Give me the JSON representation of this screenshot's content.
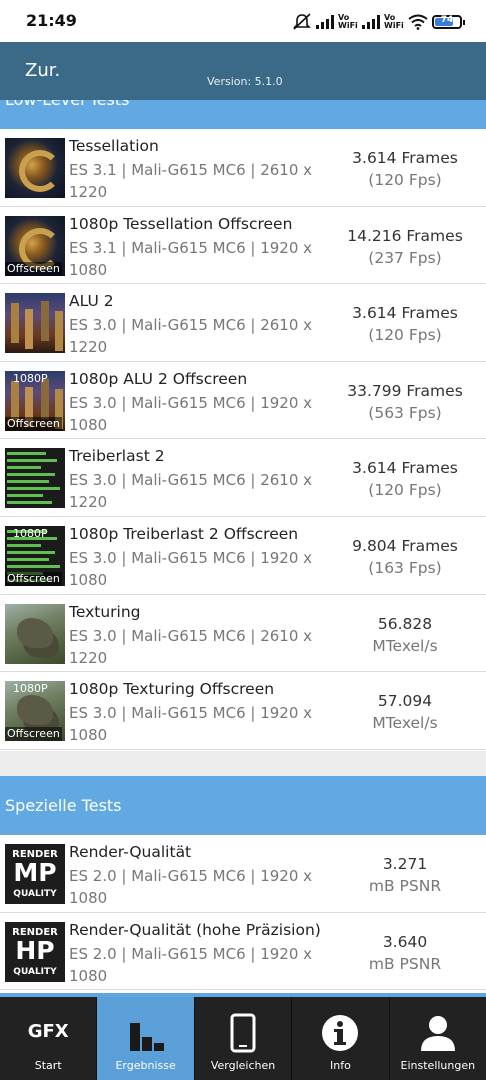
{
  "status_bar": {
    "time": "21:49",
    "network_label_1": "Vo WiFi",
    "network_label_2": "Vo WiFi",
    "battery_level": "74"
  },
  "header": {
    "back_label": "Zur.",
    "version": "Version: 5.1.0"
  },
  "sections": {
    "low_level_title": "Low-Level Tests",
    "special_title": "Spezielle Tests"
  },
  "low_level_tests": [
    {
      "title": "Tessellation",
      "api": "ES 3.1 | Mali-G615 MC6 | 2610 x 1220",
      "value": "3.614 Frames",
      "unit": "(120 Fps)",
      "thumb": "tessellation-thumbnail",
      "badge_bottom": "",
      "badge_top": ""
    },
    {
      "title": "1080p Tessellation Offscreen",
      "api": "ES 3.1 | Mali-G615 MC6 | 1920 x 1080",
      "value": "14.216 Frames",
      "unit": "(237 Fps)",
      "thumb": "tessellation-thumbnail",
      "badge_bottom": "Offscreen",
      "badge_top": ""
    },
    {
      "title": "ALU 2",
      "api": "ES 3.0 | Mali-G615 MC6 | 2610 x 1220",
      "value": "3.614 Frames",
      "unit": "(120 Fps)",
      "thumb": "alu-thumbnail",
      "badge_bottom": "",
      "badge_top": ""
    },
    {
      "title": "1080p ALU 2 Offscreen",
      "api": "ES 3.0 | Mali-G615 MC6 | 1920 x 1080",
      "value": "33.799 Frames",
      "unit": "(563 Fps)",
      "thumb": "alu-thumbnail",
      "badge_bottom": "Offscreen",
      "badge_top": "1080P"
    },
    {
      "title": "Treiberlast 2",
      "api": "ES 3.0 | Mali-G615 MC6 | 2610 x 1220",
      "value": "3.614 Frames",
      "unit": "(120 Fps)",
      "thumb": "driver-overhead-thumbnail",
      "badge_bottom": "",
      "badge_top": ""
    },
    {
      "title": "1080p Treiberlast 2 Offscreen",
      "api": "ES 3.0 | Mali-G615 MC6 | 1920 x 1080",
      "value": "9.804 Frames",
      "unit": "(163 Fps)",
      "thumb": "driver-overhead-thumbnail",
      "badge_bottom": "Offscreen",
      "badge_top": "1080P"
    },
    {
      "title": "Texturing",
      "api": "ES 3.0 | Mali-G615 MC6 | 2610 x 1220",
      "value": "56.828",
      "unit": "MTexel/s",
      "thumb": "texturing-thumbnail",
      "badge_bottom": "",
      "badge_top": ""
    },
    {
      "title": "1080p Texturing Offscreen",
      "api": "ES 3.0 | Mali-G615 MC6 | 1920 x 1080",
      "value": "57.094",
      "unit": "MTexel/s",
      "thumb": "texturing-thumbnail",
      "badge_bottom": "Offscreen",
      "badge_top": "1080P"
    }
  ],
  "special_tests": [
    {
      "title": "Render-Qualität",
      "api": "ES 2.0 | Mali-G615 MC6 | 1920 x 1080",
      "value": "3.271",
      "unit": "mB PSNR",
      "badge_top": "RENDER",
      "badge_main": "MP",
      "badge_bottom": "QUALITY"
    },
    {
      "title": "Render-Qualität (hohe Präzision)",
      "api": "ES 2.0 | Mali-G615 MC6 | 1920 x 1080",
      "value": "3.640",
      "unit": "mB PSNR",
      "badge_top": "RENDER",
      "badge_main": "HP",
      "badge_bottom": "QUALITY"
    }
  ],
  "nav": {
    "start_icon_text": "GFX",
    "items": [
      {
        "label": "Start",
        "icon": "gfx-logo-icon",
        "active": false
      },
      {
        "label": "Ergebnisse",
        "icon": "bar-chart-icon",
        "active": true
      },
      {
        "label": "Vergleichen",
        "icon": "smartphone-icon",
        "active": false
      },
      {
        "label": "Info",
        "icon": "info-icon",
        "active": false
      },
      {
        "label": "Einstellungen",
        "icon": "user-icon",
        "active": false
      }
    ]
  },
  "colors": {
    "appbar": "#3a6a88",
    "section_header": "#62a9e3",
    "nav_background": "#222222",
    "nav_active": "#5a9fd8"
  }
}
